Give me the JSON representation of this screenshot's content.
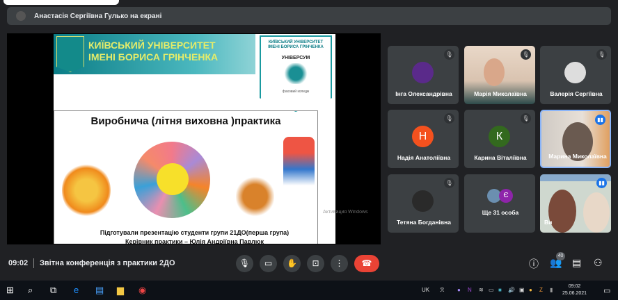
{
  "presenter_banner": "Анастасія Сергіївна Гулько на екрані",
  "slide": {
    "university": [
      "КИЇВСЬКИЙ УНІВЕРСИТЕТ",
      "ІМЕНІ БОРИСА ГРІНЧЕНКА"
    ],
    "shield_top": [
      "КИЇВСЬКИЙ УНІВЕРСИТЕТ",
      "ІМЕНІ БОРИСА ГРІНЧЕНКА"
    ],
    "shield_name": "УНІВЕРСУМ",
    "shield_sub": "фаховий коледж",
    "title": "Виробнича (літня виховна )практика",
    "caption1": "Підготували презентацію студенти групи 21ДО(перша група)",
    "caption2": "Керівник практики – Юлія Андріївна Павлюк",
    "watermark": "Активация Windows"
  },
  "participants": [
    {
      "name": "Інга Олександрівна",
      "muted": true,
      "avatar": "photo"
    },
    {
      "name": "Марія Миколаївна",
      "muted": true,
      "avatar": "video"
    },
    {
      "name": "Валерія Сергіївна",
      "muted": true,
      "avatar": "photo"
    },
    {
      "name": "Надія Анатоліївна",
      "muted": true,
      "initial": "Н",
      "color": "#f4511e"
    },
    {
      "name": "Карина Віталіївна",
      "muted": true,
      "initial": "К",
      "color": "#33691e"
    },
    {
      "name": "Марина Миколаївна",
      "speaking": true,
      "avatar": "video"
    },
    {
      "name": "Тетяна Богданівна",
      "muted": true,
      "avatar": "photo"
    },
    {
      "name": "Ще 31 особа",
      "initial": "Є",
      "color": "#8e24aa"
    },
    {
      "name": "Ви",
      "speaking": true,
      "avatar": "video"
    }
  ],
  "bottom_bar": {
    "time": "09:02",
    "meeting_title": "Звітна конференція з практики 2ДО",
    "participants_count": "40"
  },
  "taskbar": {
    "language": "UK",
    "clock_time": "09:02",
    "clock_date": "25.06.2021"
  }
}
